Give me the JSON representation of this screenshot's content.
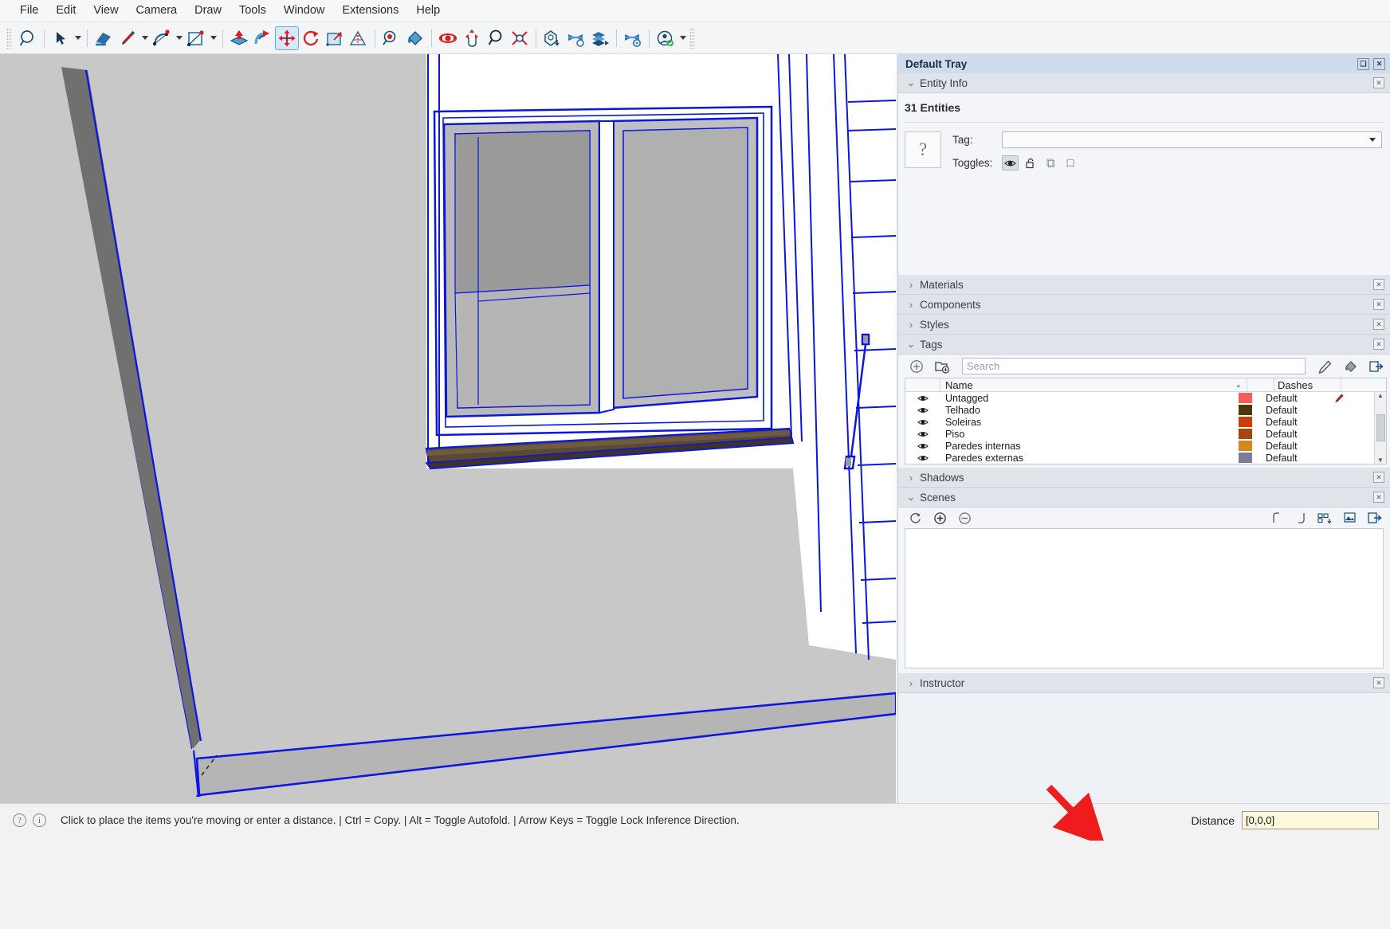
{
  "menu": {
    "items": [
      "File",
      "Edit",
      "View",
      "Camera",
      "Draw",
      "Tools",
      "Window",
      "Extensions",
      "Help"
    ]
  },
  "toolbar": {
    "items": [
      {
        "name": "zoom-extents-magnifier-icon",
        "label": "Zoom"
      },
      {
        "name": "select-arrow-icon",
        "label": "Select"
      },
      {
        "name": "eraser-icon",
        "label": "Eraser"
      },
      {
        "name": "pencil-line-icon",
        "label": "Line"
      },
      {
        "name": "arc-icon",
        "label": "Arc"
      },
      {
        "name": "rectangle-icon",
        "label": "Rectangle"
      },
      {
        "name": "push-pull-icon",
        "label": "Push/Pull"
      },
      {
        "name": "follow-me-icon",
        "label": "Follow Me"
      },
      {
        "name": "move-icon",
        "label": "Move"
      },
      {
        "name": "rotate-icon",
        "label": "Rotate"
      },
      {
        "name": "scale-icon",
        "label": "Scale"
      },
      {
        "name": "tape-measure-icon",
        "label": "Tape Measure"
      },
      {
        "name": "paint-bucket-icon",
        "label": "Paint Bucket"
      },
      {
        "name": "position-camera-icon",
        "label": "Position Camera"
      },
      {
        "name": "orbit-icon",
        "label": "Orbit"
      },
      {
        "name": "pan-icon",
        "label": "Pan"
      },
      {
        "name": "zoom-icon",
        "label": "Zoom"
      },
      {
        "name": "zoom-extents-icon",
        "label": "Zoom Extents"
      },
      {
        "name": "model-info-icon",
        "label": "Model Info"
      },
      {
        "name": "section-plane-icon",
        "label": "Section Plane"
      },
      {
        "name": "layers-icon",
        "label": "Layers"
      },
      {
        "name": "solid-tools-icon",
        "label": "Solid Tools"
      },
      {
        "name": "user-account-icon",
        "label": "Account"
      },
      {
        "name": "new-document-icon",
        "label": "New"
      },
      {
        "name": "person-icon",
        "label": "Person"
      }
    ]
  },
  "tray": {
    "title": "Default Tray",
    "window_buttons": {
      "float": "❏",
      "close": "✕"
    },
    "entity_info": {
      "title": "Entity Info",
      "count": "31 Entities",
      "thumbnail_glyph": "?",
      "tag_label": "Tag:",
      "tag_value": "",
      "toggles_label": "Toggles:",
      "toggle_icons": [
        "eye-icon",
        "unlock-icon",
        "cast-shadows-icon",
        "receive-shadows-icon"
      ]
    },
    "materials": {
      "title": "Materials"
    },
    "components": {
      "title": "Components"
    },
    "styles": {
      "title": "Styles"
    },
    "tags": {
      "title": "Tags",
      "add_tag_icon": "add-tag-icon",
      "add_folder_icon": "add-folder-icon",
      "search_placeholder": "Search",
      "dash_edit_icon": "dash-edit-icon",
      "color_icon": "color-by-tag-icon",
      "details_icon": "details-arrow-icon",
      "columns": [
        "",
        "Name",
        "",
        "Dashes",
        ""
      ],
      "rows": [
        {
          "visible": true,
          "name": "Untagged",
          "color": "#fc5b5b",
          "dashes": "Default"
        },
        {
          "visible": true,
          "name": "Telhado",
          "color": "#4b3a09",
          "dashes": "Default"
        },
        {
          "visible": true,
          "name": "Soleiras",
          "color": "#cb3d0b",
          "dashes": "Default"
        },
        {
          "visible": true,
          "name": "Piso",
          "color": "#a74410",
          "dashes": "Default"
        },
        {
          "visible": true,
          "name": "Paredes internas",
          "color": "#d4881b",
          "dashes": "Default"
        },
        {
          "visible": true,
          "name": "Paredes externas",
          "color": "#7b7b9b",
          "dashes": "Default"
        }
      ]
    },
    "shadows": {
      "title": "Shadows"
    },
    "scenes": {
      "title": "Scenes",
      "toolbar_icons": [
        "refresh-icon",
        "add-scene-icon",
        "remove-scene-icon"
      ],
      "right_icons": [
        "move-scene-up-icon",
        "move-scene-down-icon",
        "view-options-icon",
        "thumbnail-icon",
        "details-arrow-icon"
      ],
      "items": []
    },
    "instructor": {
      "title": "Instructor"
    }
  },
  "statusbar": {
    "help_glyph": "?",
    "info_glyph": "i",
    "message": "Click to place the items you're moving or enter a distance.  |  Ctrl = Copy.  |  Alt = Toggle Autofold.  |  Arrow Keys = Toggle Lock Inference Direction.",
    "measurement_label": "Distance",
    "measurement_value": "[0,0,0]"
  },
  "annotation": {
    "arrow_color": "#ee1c1c",
    "points_to": "measurement-value-box"
  },
  "colors": {
    "viewport_bg": "#c8c8c8",
    "selection_blue": "#0b16e0",
    "tray_header": "#cfdced",
    "measurement_field": "#fdf8dc"
  }
}
